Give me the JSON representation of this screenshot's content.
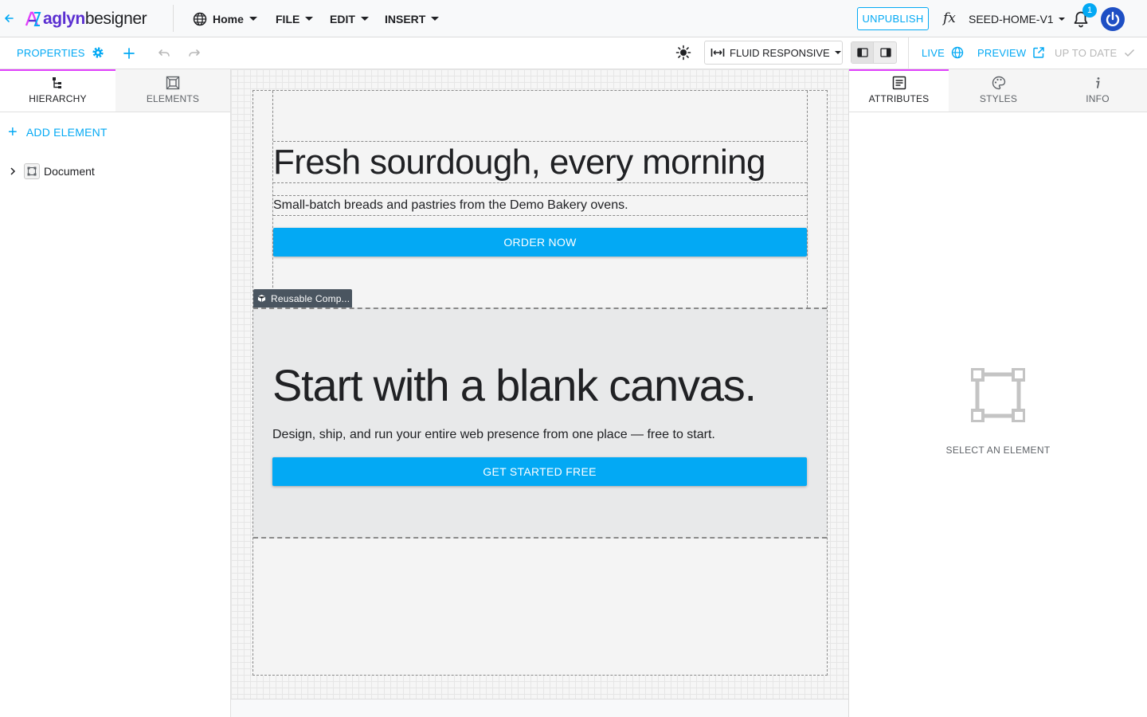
{
  "app": {
    "logo_brand": "aglyn",
    "logo_suffix": "besigner"
  },
  "menu": {
    "home": "Home",
    "file": "FILE",
    "edit": "EDIT",
    "insert": "INSERT"
  },
  "header": {
    "unpublish": "UNPUBLISH",
    "fx": "fx",
    "version": "SEED-HOME-V1",
    "notification_count": "1"
  },
  "toolbar": {
    "properties": "PROPERTIES",
    "fluid": "FLUID RESPONSIVE",
    "live": "LIVE",
    "preview": "PREVIEW",
    "status": "UP TO DATE"
  },
  "left_tabs": [
    {
      "label": "HIERARCHY",
      "icon": "hierarchy-icon",
      "active": true
    },
    {
      "label": "ELEMENTS",
      "icon": "elements-icon",
      "active": false
    }
  ],
  "hierarchy": {
    "add_element": "ADD ELEMENT",
    "root": "Document"
  },
  "canvas": {
    "hero_title": "Fresh sourdough, every morning",
    "hero_sub": "Small-batch breads and pastries from the Demo Bakery ovens.",
    "hero_button": "ORDER NOW",
    "reusable_tag": "Reusable Comp...",
    "cta_title": "Start with a blank canvas.",
    "cta_sub": "Design, ship, and run your entire web presence from one place — free to start.",
    "cta_button": "GET STARTED FREE"
  },
  "right_tabs": [
    {
      "label": "ATTRIBUTES",
      "icon": "attributes-icon",
      "active": true
    },
    {
      "label": "STYLES",
      "icon": "palette-icon",
      "active": false
    },
    {
      "label": "INFO",
      "icon": "info-icon",
      "active": false
    }
  ],
  "right_panel": {
    "empty_label": "SELECT AN ELEMENT"
  },
  "colors": {
    "accent": "#03a9f4",
    "tab_indicator": "#e040fb",
    "brand_purple": "#5b2fd1",
    "avatar": "#1e4fc4",
    "reusable_tag": "#4a5560"
  }
}
